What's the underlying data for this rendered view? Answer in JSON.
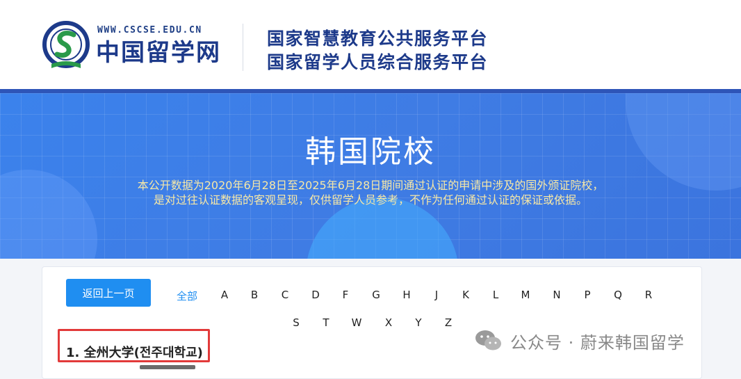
{
  "header": {
    "site_url": "WWW.CSCSE.EDU.CN",
    "site_name": "中国留学网",
    "platform_line_1": "国家智慧教育公共服务平台",
    "platform_line_2": "国家留学人员综合服务平台"
  },
  "banner": {
    "title": "韩国院校",
    "note_line_1": "本公开数据为2020年6月28日至2025年6月28日期间通过认证的申请中涉及的国外颁证院校，",
    "note_line_2": "是对过往认证数据的客观呈现，仅供留学人员参考，不作为任何通过认证的保证或依据。"
  },
  "filter": {
    "back_label": "返回上一页",
    "all_label": "全部",
    "letters": [
      "A",
      "B",
      "C",
      "D",
      "F",
      "G",
      "H",
      "J",
      "K",
      "L",
      "M",
      "N",
      "P",
      "Q",
      "R",
      "S",
      "T",
      "W",
      "X",
      "Y",
      "Z"
    ]
  },
  "results": {
    "first_item": "1.  全州大学(전주대학교)"
  },
  "watermark": {
    "text": "公众号 · 蔚来韩国留学"
  },
  "colors": {
    "accent": "#1f8ef1",
    "brand_navy": "#1d3a8a",
    "banner_blue": "#3a7ae4",
    "note_yellow": "#f7e8a6",
    "highlight_red": "#e23a3a"
  }
}
